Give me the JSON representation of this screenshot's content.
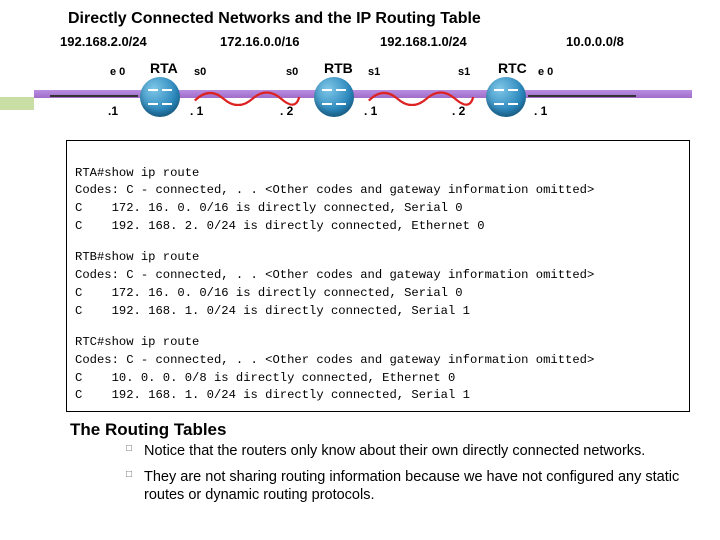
{
  "title": "Directly Connected Networks and the IP Routing Table",
  "diagram": {
    "nets": [
      "192.168.2.0/24",
      "172.16.0.0/16",
      "192.168.1.0/24",
      "10.0.0.0/8"
    ],
    "routers": [
      {
        "name": "RTA",
        "leftIf": "e 0",
        "rightIf": "s0",
        "leftSub": ".1",
        "rightSub": ". 1"
      },
      {
        "name": "RTB",
        "leftIf": "s0",
        "rightIf": "s1",
        "leftSub": ". 2",
        "rightSub": ". 1"
      },
      {
        "name": "RTC",
        "leftIf": "s1",
        "rightIf": "e 0",
        "leftSub": ". 2",
        "rightSub": ". 1"
      }
    ]
  },
  "code": {
    "rta": {
      "l1": "RTA#show ip route",
      "l2": "Codes: C - connected, . . <Other codes and gateway information omitted>",
      "l3": "C    172. 16. 0. 0/16 is directly connected, Serial 0",
      "l4": "C    192. 168. 2. 0/24 is directly connected, Ethernet 0"
    },
    "rtb": {
      "l1": "RTB#show ip route",
      "l2": "Codes: C - connected, . . <Other codes and gateway information omitted>",
      "l3": "C    172. 16. 0. 0/16 is directly connected, Serial 0",
      "l4": "C    192. 168. 1. 0/24 is directly connected, Serial 1"
    },
    "rtc": {
      "l1": "RTC#show ip route",
      "l2": "Codes: C - connected, . . <Other codes and gateway information omitted>",
      "l3": "C    10. 0. 0. 0/8 is directly connected, Ethernet 0",
      "l4": "C    192. 168. 1. 0/24 is directly connected, Serial 1"
    }
  },
  "subheading": "The Routing Tables",
  "bullets": {
    "b1": "Notice that the routers only know about their own directly connected networks.",
    "b2": "They are not sharing routing information because we have not configured any static routes or dynamic routing protocols."
  }
}
